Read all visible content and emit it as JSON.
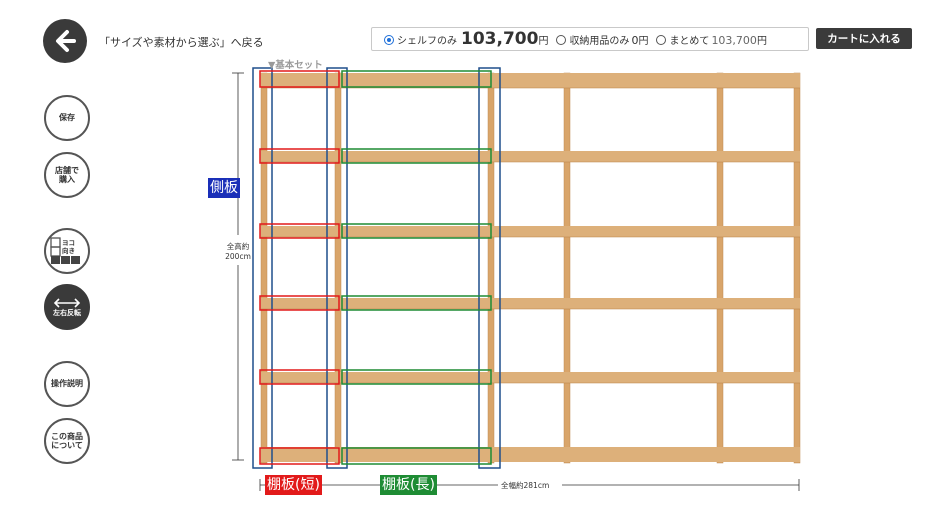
{
  "header": {
    "back_label": "「サイズや素材から選ぶ」へ戻る"
  },
  "price_options": [
    {
      "label": "シェルフのみ",
      "price": "103,700",
      "unit": "円",
      "selected": true
    },
    {
      "label": "収納用品のみ",
      "price": "0",
      "unit": "円",
      "selected": false
    },
    {
      "label": "まとめて",
      "price": "103,700",
      "unit": "円",
      "selected": false
    }
  ],
  "cart_button": "カートに入れる",
  "side_buttons": {
    "save": "保存",
    "store_buy_1": "店舗で",
    "store_buy_2": "購入",
    "yoko_1": "ヨコ",
    "yoko_2": "向き",
    "flip": "左右反転",
    "guide": "操作説明",
    "about_1": "この商品",
    "about_2": "について"
  },
  "diagram": {
    "set_label": "▼基本セット",
    "side_panel_label": "側板",
    "short_shelf_label": "棚板(短)",
    "long_shelf_label": "棚板(長)",
    "height_label_1": "全高約",
    "height_label_2": "200cm",
    "width_label": "全幅約281cm"
  },
  "colors": {
    "wood": "#d9a56a",
    "side_marker": "#1f4f8c",
    "short_marker": "#e21a1a",
    "long_marker": "#1e8c34"
  }
}
